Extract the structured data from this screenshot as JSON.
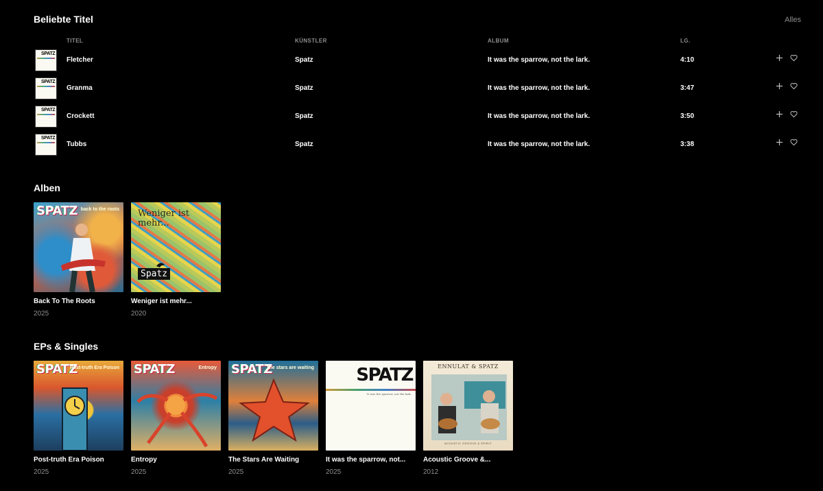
{
  "popular": {
    "title": "Beliebte Titel",
    "see_all": "Alles",
    "columns": {
      "title": "TITEL",
      "artist": "KÜNSTLER",
      "album": "ALBUM",
      "length": "LG."
    },
    "cover_logo": "SPATZ",
    "tracks": [
      {
        "title": "Fletcher",
        "artist": "Spatz",
        "album": "It was the sparrow, not the lark.",
        "length": "4:10"
      },
      {
        "title": "Granma",
        "artist": "Spatz",
        "album": "It was the sparrow, not the lark.",
        "length": "3:47"
      },
      {
        "title": "Crockett",
        "artist": "Spatz",
        "album": "It was the sparrow, not the lark.",
        "length": "3:50"
      },
      {
        "title": "Tubbs",
        "artist": "Spatz",
        "album": "It was the sparrow, not the lark.",
        "length": "3:38"
      }
    ],
    "icons": {
      "add": "plus-icon",
      "like": "heart-icon"
    }
  },
  "albums": {
    "title": "Alben",
    "items": [
      {
        "title": "Back To The Roots",
        "year": "2025",
        "art_logo": "SPATZ",
        "art_sub": "back to the roots"
      },
      {
        "title": "Weniger ist mehr...",
        "year": "2020",
        "art_text": "Weniger ist mehr...",
        "art_logo": "Spatz"
      }
    ]
  },
  "singles": {
    "title": "EPs & Singles",
    "items": [
      {
        "title": "Post-truth Era Poison",
        "year": "2025",
        "art_logo": "SPATZ",
        "art_sub": "Post-truth Era Poison"
      },
      {
        "title": "Entropy",
        "year": "2025",
        "art_logo": "SPATZ",
        "art_sub": "Entropy"
      },
      {
        "title": "The Stars Are Waiting",
        "year": "2025",
        "art_logo": "SPATZ",
        "art_sub": "The stars are waiting"
      },
      {
        "title": "It was the sparrow, not...",
        "year": "2025",
        "art_logo": "SPATZ",
        "art_sub": "It was the sparrow, not the lark."
      },
      {
        "title": "Acoustic Groove &...",
        "year": "2012",
        "art_logo": "ENNULAT & SPATZ",
        "art_sub": "ACOUSTIC GROOVE & SPIRIT"
      }
    ]
  }
}
